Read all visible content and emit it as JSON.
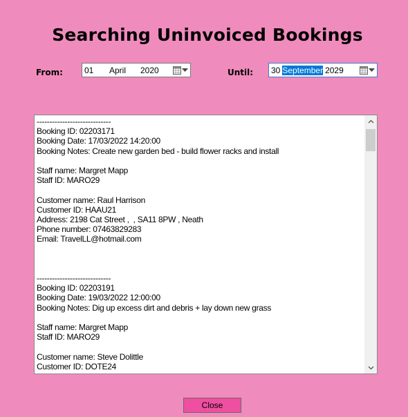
{
  "window": {
    "title": "Searching Uninvoiced Bookings"
  },
  "colors": {
    "background": "#f08bbd",
    "button": "#ee4fa0",
    "selection": "#0078d7"
  },
  "filters": {
    "from_label": "From:",
    "until_label": "Until:",
    "from": {
      "day": "01",
      "month": "April",
      "year": "2020"
    },
    "until": {
      "day": "30",
      "month": "September",
      "year": "2029",
      "selected_segment": "month"
    }
  },
  "results": {
    "lines": [
      "-----------------------------",
      "Booking ID: 02203171",
      "Booking Date: 17/03/2022 14:20:00",
      "Booking Notes: Create new garden bed - build flower racks and install",
      "",
      "Staff name: Margret Mapp",
      "Staff ID: MARO29",
      "",
      "Customer name: Raul Harrison",
      "Customer ID: HAAU21",
      "Address: 2198 Cat Street ,  , SA11 8PW , Neath",
      "Phone number: 07463829283",
      "Email: TravelLL@hotmail.com",
      "",
      "",
      "",
      "-----------------------------",
      "Booking ID: 02203191",
      "Booking Date: 19/03/2022 12:00:00",
      "Booking Notes: Dig up excess dirt and debris + lay down new grass",
      "",
      "Staff name: Margret Mapp",
      "Staff ID: MARO29",
      "",
      "Customer name: Steve Dolittle",
      "Customer ID: DOTE24"
    ]
  },
  "buttons": {
    "close_label": "Close"
  },
  "icons": {
    "calendar": "calendar-icon",
    "dropdown": "triangle-down",
    "scroll_up": "chevron-up",
    "scroll_down": "chevron-down"
  }
}
